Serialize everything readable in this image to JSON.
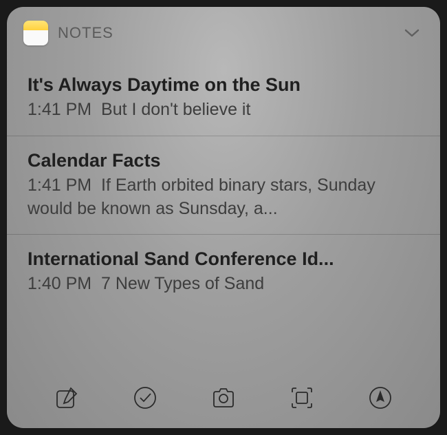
{
  "header": {
    "app_title": "NOTES"
  },
  "notes": [
    {
      "title": "It's Always Daytime on the Sun",
      "time": "1:41 PM",
      "preview": "But I don't believe it"
    },
    {
      "title": "Calendar Facts",
      "time": "1:41 PM",
      "preview": "If Earth orbited binary stars, Sunday would be known as Sunsday, a..."
    },
    {
      "title": "International Sand Conference Id...",
      "time": "1:40 PM",
      "preview": "7 New Types of Sand"
    }
  ]
}
